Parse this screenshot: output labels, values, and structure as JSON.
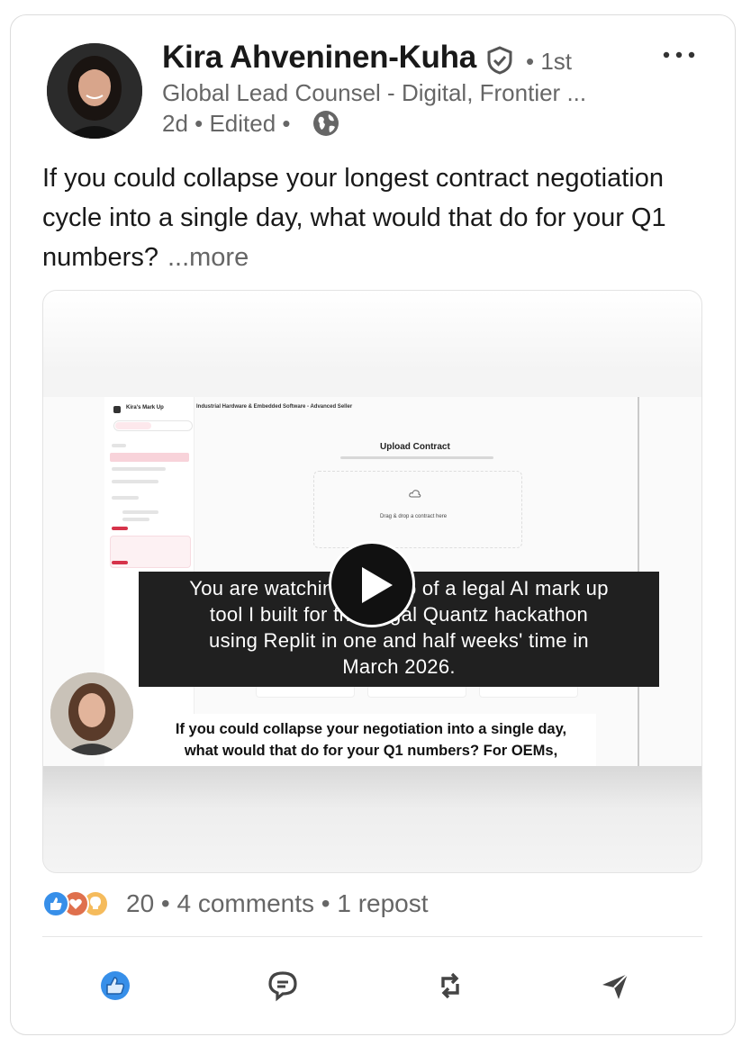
{
  "post": {
    "author": {
      "name": "Kira Ahveninen-Kuha",
      "degree": "• 1st",
      "headline": "Global Lead Counsel - Digital, Frontier ...",
      "meta": "2d • Edited •"
    },
    "text": "If you could collapse your longest contract negotiation cycle into a single day, what would that do for your Q1 numbers?",
    "see_more": "...more",
    "menu_icon": "more-horizontal-icon"
  },
  "video": {
    "app": {
      "logo": "Kira's Mark Up",
      "header": "Industrial Hardware & Embedded Software - Advanced Seller",
      "upload_title": "Upload Contract",
      "drop_text": "Drag & drop a contract here"
    },
    "caption_lines": [
      "You are watching a video of a legal AI mark up",
      "tool I built for the Legal Quantz hackathon",
      "using Replit in one and half weeks' time in",
      "March 2026."
    ],
    "subtitle_lines": [
      "If you could collapse your negotiation into a single day,",
      "what would that do for your Q1 numbers? For OEMs,"
    ]
  },
  "social": {
    "reaction_icons": [
      "like-icon",
      "love-icon",
      "insightful-icon"
    ],
    "counts": "20 • 4 comments • 1 repost"
  },
  "actions": [
    "like-icon",
    "comment-icon",
    "repost-icon",
    "send-icon"
  ],
  "colors": {
    "like_blue": "#378fe9",
    "love_red": "#df704d",
    "insight_yellow": "#f5bb5c",
    "muted_text": "#666666"
  }
}
